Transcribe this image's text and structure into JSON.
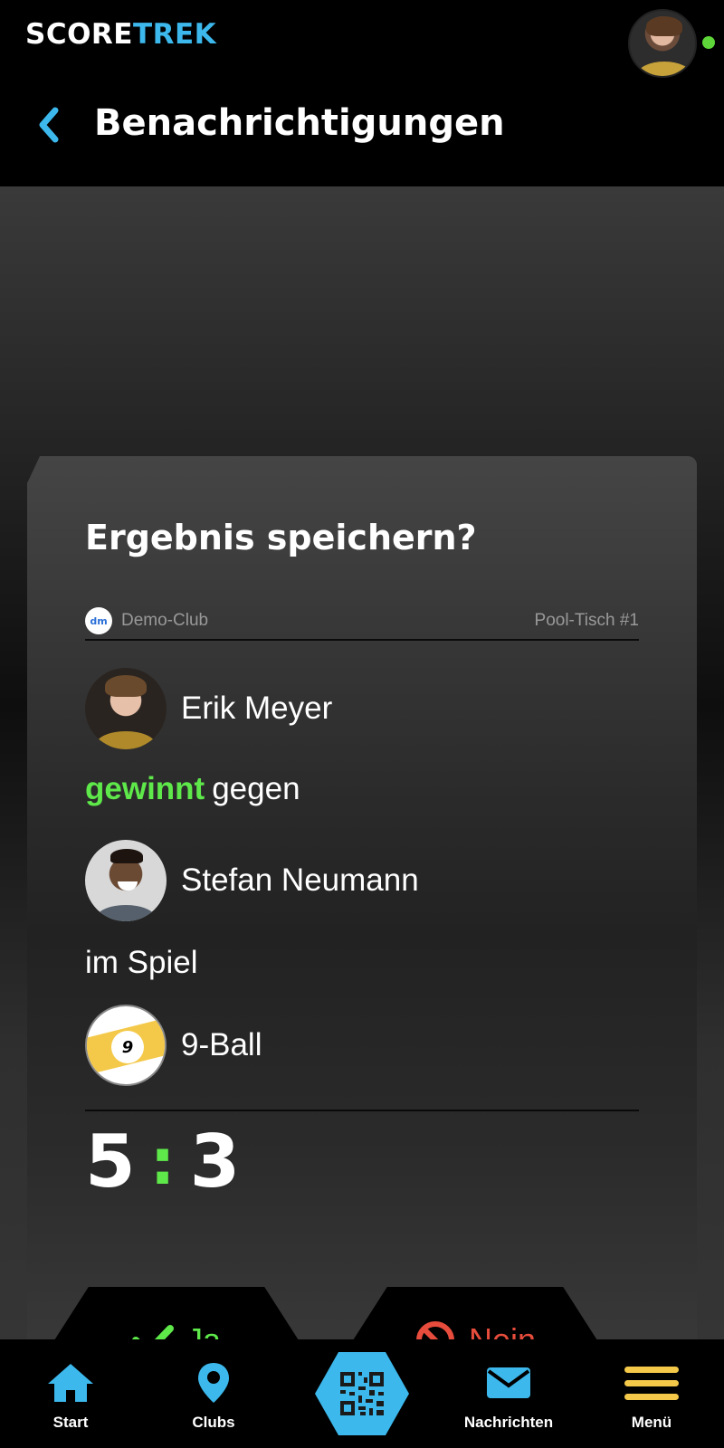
{
  "app": {
    "logo_part1": "SCORE",
    "logo_part2": "TREK",
    "brand_color": "#3cb8ec"
  },
  "header": {
    "title": "Benachrichtigungen",
    "back_icon": "chevron-left-icon",
    "user_online": true
  },
  "card": {
    "title": "Ergebnis speichern?",
    "club_logo_text": "dm",
    "club_name": "Demo-Club",
    "table_name": "Pool-Tisch #1",
    "winner_name": "Erik Meyer",
    "result_word": "gewinnt",
    "against_word": "gegen",
    "loser_name": "Stefan Neumann",
    "in_game_text": "im Spiel",
    "game_ball_number": "9",
    "game_name": "9-Ball",
    "score_winner": "5",
    "score_separator": ":",
    "score_loser": "3",
    "yes_label": "Ja",
    "no_label": "Nein",
    "accent_green": "#5ee84a",
    "accent_red": "#e74c3c"
  },
  "nav": {
    "items": [
      {
        "label": "Start",
        "icon": "home-icon"
      },
      {
        "label": "Clubs",
        "icon": "map-pin-icon"
      },
      {
        "label": "",
        "icon": "qr-code-icon"
      },
      {
        "label": "Nachrichten",
        "icon": "envelope-icon"
      },
      {
        "label": "Menü",
        "icon": "hamburger-menu-icon"
      }
    ]
  }
}
